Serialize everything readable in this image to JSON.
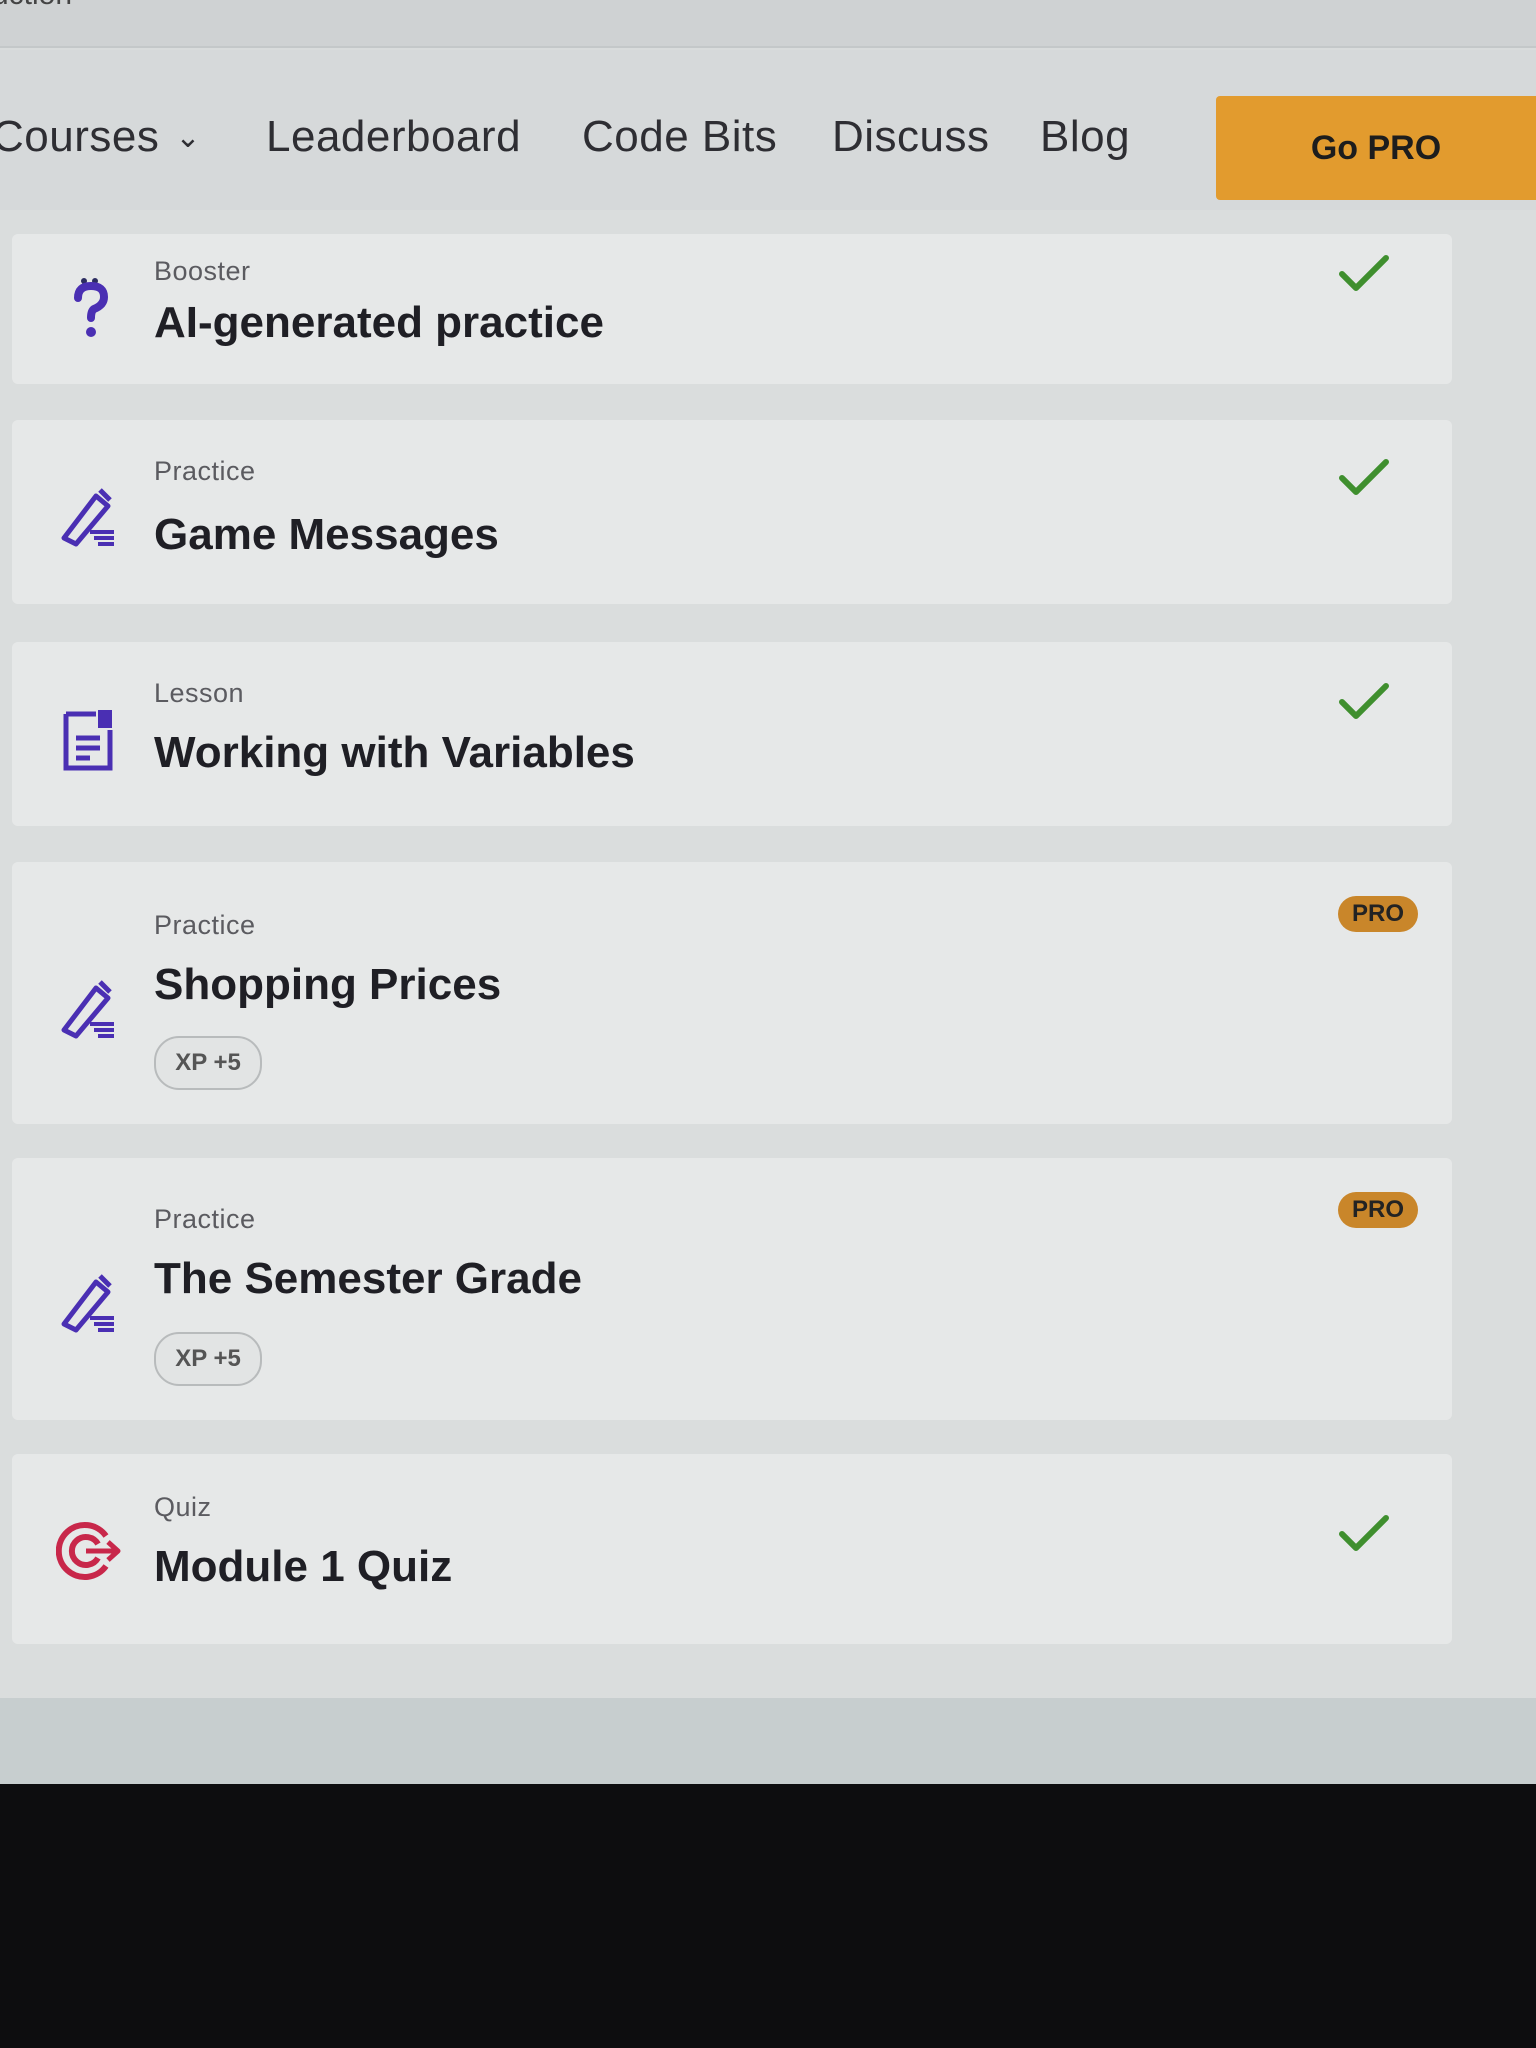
{
  "header_partial": "uction",
  "nav": {
    "courses": "Courses",
    "leaderboard": "Leaderboard",
    "code_bits": "Code Bits",
    "discuss": "Discuss",
    "blog": "Blog",
    "go_pro": "Go PRO"
  },
  "items": [
    {
      "type": "Booster",
      "title": "AI-generated practice",
      "icon": "question-icon",
      "status": "completed"
    },
    {
      "type": "Practice",
      "title": "Game Messages",
      "icon": "pencil-icon",
      "status": "completed"
    },
    {
      "type": "Lesson",
      "title": "Working with Variables",
      "icon": "lesson-icon",
      "status": "completed"
    },
    {
      "type": "Practice",
      "title": "Shopping Prices",
      "icon": "pencil-icon",
      "badge": "PRO",
      "xp": "XP +5"
    },
    {
      "type": "Practice",
      "title": "The Semester Grade",
      "icon": "pencil-icon",
      "badge": "PRO",
      "xp": "XP +5"
    },
    {
      "type": "Quiz",
      "title": "Module 1 Quiz",
      "icon": "target-icon",
      "status": "completed"
    }
  ],
  "colors": {
    "accent_purple": "#4a2fb3",
    "check_green": "#3f8f2e",
    "pro_orange": "#e29b2e",
    "quiz_red": "#c8274a"
  }
}
